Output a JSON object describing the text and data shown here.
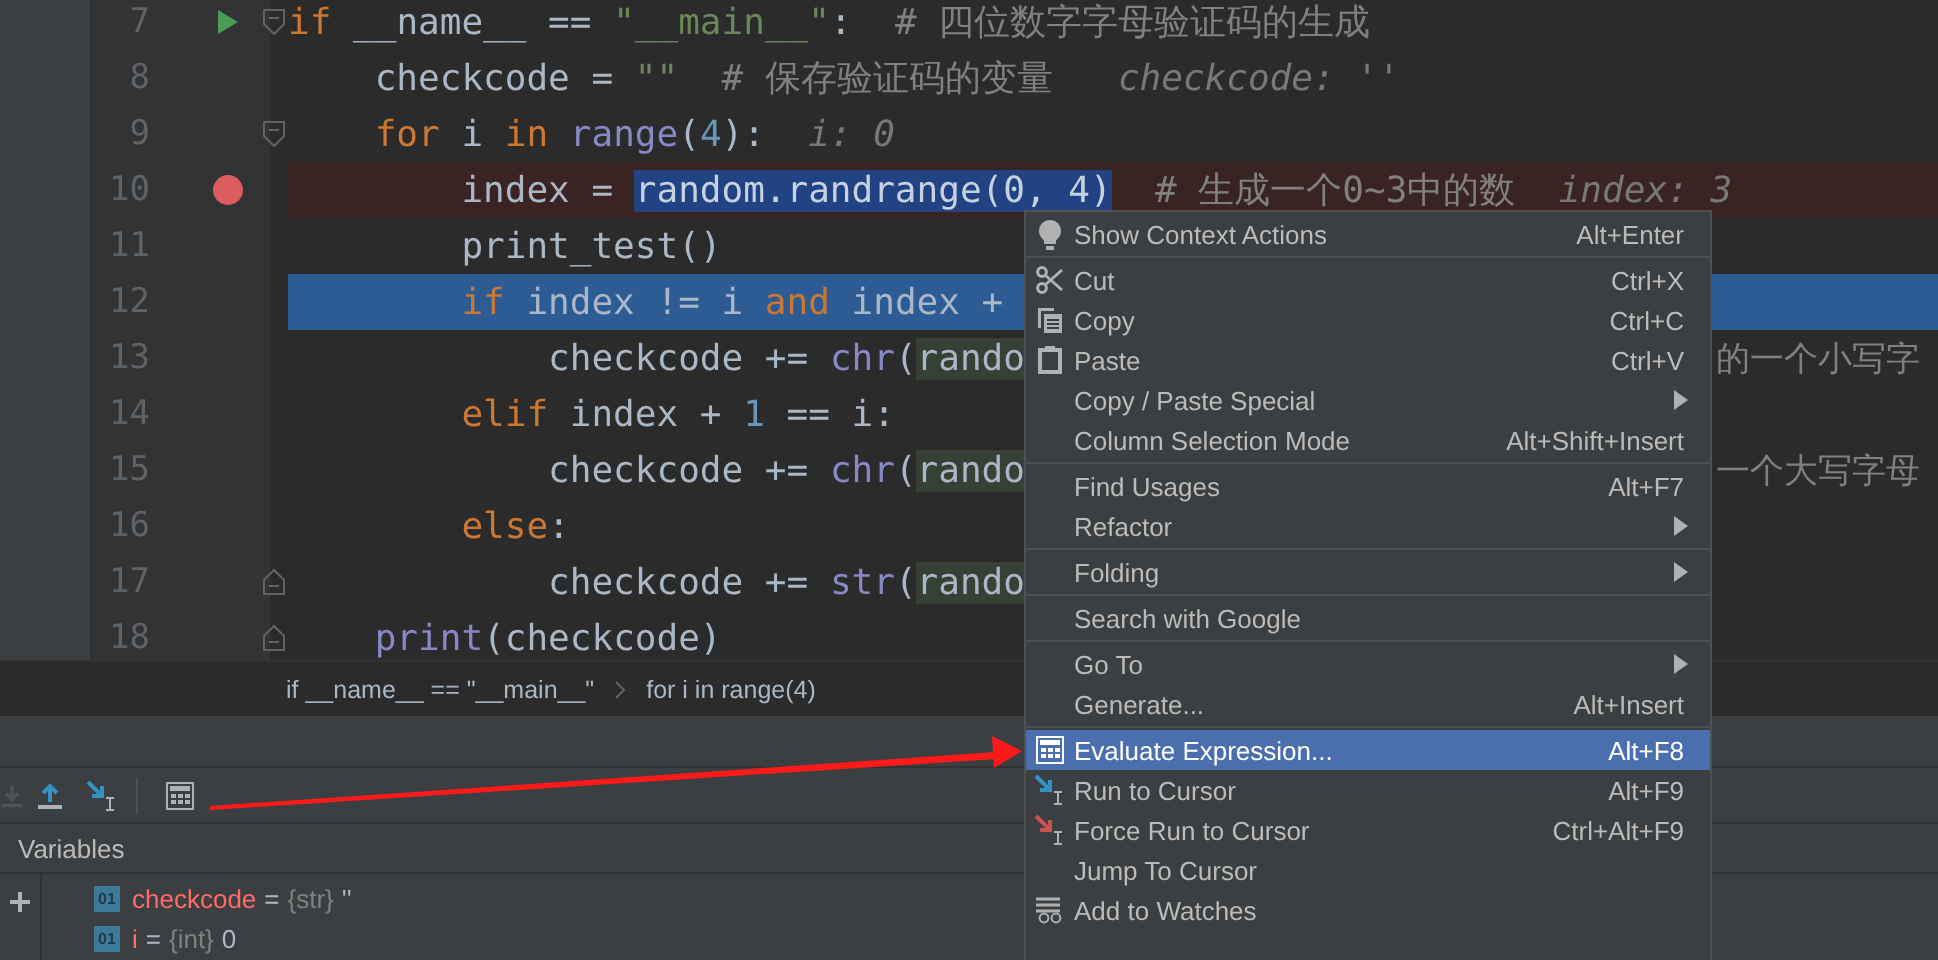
{
  "editor": {
    "lines": [
      {
        "number": "7",
        "breakpoint": false,
        "current": false,
        "tokens": [
          {
            "kind": "kw",
            "text": "if"
          },
          {
            "kind": "plain",
            "text": " __name__ == "
          },
          {
            "kind": "str",
            "text": "\"__main__\""
          },
          {
            "kind": "plain",
            "text": ":  "
          },
          {
            "kind": "comment",
            "text": "# 四位数字字母验证码的生成"
          }
        ]
      },
      {
        "number": "8",
        "breakpoint": false,
        "current": false,
        "tokens": [
          {
            "kind": "plain",
            "text": "    checkcode = "
          },
          {
            "kind": "str",
            "text": "\"\""
          },
          {
            "kind": "comment",
            "text": "  # 保存验证码的变量"
          },
          {
            "kind": "hint",
            "text": "   checkcode: ''"
          }
        ]
      },
      {
        "number": "9",
        "breakpoint": false,
        "current": false,
        "tokens": [
          {
            "kind": "kw",
            "text": "    for"
          },
          {
            "kind": "plain",
            "text": " i "
          },
          {
            "kind": "kw",
            "text": "in"
          },
          {
            "kind": "builtin",
            "text": " range"
          },
          {
            "kind": "plain",
            "text": "("
          },
          {
            "kind": "num",
            "text": "4"
          },
          {
            "kind": "plain",
            "text": "):"
          },
          {
            "kind": "hint",
            "text": "  i: 0"
          }
        ]
      },
      {
        "number": "10",
        "breakpoint": true,
        "current": false,
        "tokens": [
          {
            "kind": "plain",
            "text": "        index = "
          },
          {
            "kind": "selected",
            "text": "random.randrange(0, 4)"
          },
          {
            "kind": "comment",
            "text": "  # 生成一个0~3中的数"
          },
          {
            "kind": "hint",
            "text": "  index: 3"
          }
        ]
      },
      {
        "number": "11",
        "breakpoint": false,
        "current": false,
        "tokens": [
          {
            "kind": "plain",
            "text": "        print_test()"
          }
        ]
      },
      {
        "number": "12",
        "breakpoint": false,
        "current": true,
        "tokens": [
          {
            "kind": "kw",
            "text": "        if"
          },
          {
            "kind": "plain",
            "text": " index != i "
          },
          {
            "kind": "kw",
            "text": "and"
          },
          {
            "kind": "plain",
            "text": " index +"
          }
        ]
      },
      {
        "number": "13",
        "breakpoint": false,
        "current": false,
        "tokens": [
          {
            "kind": "plain",
            "text": "            checkcode += "
          },
          {
            "kind": "builtin",
            "text": "chr"
          },
          {
            "kind": "plain",
            "text": "("
          },
          {
            "kind": "matched",
            "text": "rando"
          }
        ],
        "tail": "的一个小写字"
      },
      {
        "number": "14",
        "breakpoint": false,
        "current": false,
        "tokens": [
          {
            "kind": "kw",
            "text": "        elif"
          },
          {
            "kind": "plain",
            "text": " index + "
          },
          {
            "kind": "num",
            "text": "1"
          },
          {
            "kind": "plain",
            "text": " == i:"
          }
        ]
      },
      {
        "number": "15",
        "breakpoint": false,
        "current": false,
        "tokens": [
          {
            "kind": "plain",
            "text": "            checkcode += "
          },
          {
            "kind": "builtin",
            "text": "chr"
          },
          {
            "kind": "plain",
            "text": "("
          },
          {
            "kind": "matched",
            "text": "rando"
          }
        ],
        "tail": "一个大写字母"
      },
      {
        "number": "16",
        "breakpoint": false,
        "current": false,
        "tokens": [
          {
            "kind": "kw",
            "text": "        else"
          },
          {
            "kind": "plain",
            "text": ":"
          }
        ]
      },
      {
        "number": "17",
        "breakpoint": false,
        "current": false,
        "tokens": [
          {
            "kind": "plain",
            "text": "            checkcode += "
          },
          {
            "kind": "builtin",
            "text": "str"
          },
          {
            "kind": "plain",
            "text": "("
          },
          {
            "kind": "matched",
            "text": "rando"
          }
        ]
      },
      {
        "number": "18",
        "breakpoint": false,
        "current": false,
        "tokens": [
          {
            "kind": "builtin",
            "text": "    print"
          },
          {
            "kind": "plain",
            "text": "(checkcode)"
          }
        ]
      }
    ]
  },
  "breadcrumbs": [
    "if __name__ == \"__main__\"",
    "for i in range(4)"
  ],
  "debug_toolbar": [
    {
      "kind": "button",
      "disabled": true
    },
    {
      "kind": "button",
      "disabled": false
    },
    {
      "kind": "button",
      "disabled": false
    },
    {
      "kind": "separator"
    },
    {
      "kind": "button",
      "disabled": false
    }
  ],
  "variables": {
    "title": "Variables",
    "items": [
      {
        "badge": "01",
        "name": "checkcode",
        "separator": "=",
        "type": "{str}",
        "value": "''"
      },
      {
        "badge": "01",
        "name": "i",
        "separator": "=",
        "type": "{int}",
        "value": "0"
      }
    ]
  },
  "context_menu": [
    {
      "kind": "item",
      "label": "Show Context Actions",
      "shortcut": "Alt+Enter",
      "submenu": false,
      "selected": false
    },
    {
      "kind": "separator"
    },
    {
      "kind": "item",
      "label": "Cut",
      "shortcut": "Ctrl+X",
      "submenu": false,
      "selected": false
    },
    {
      "kind": "item",
      "label": "Copy",
      "shortcut": "Ctrl+C",
      "submenu": false,
      "selected": false
    },
    {
      "kind": "item",
      "label": "Paste",
      "shortcut": "Ctrl+V",
      "submenu": false,
      "selected": false
    },
    {
      "kind": "item",
      "label": "Copy / Paste Special",
      "submenu": true,
      "selected": false
    },
    {
      "kind": "item",
      "label": "Column Selection Mode",
      "shortcut": "Alt+Shift+Insert",
      "submenu": false,
      "selected": false
    },
    {
      "kind": "separator"
    },
    {
      "kind": "item",
      "label": "Find Usages",
      "shortcut": "Alt+F7",
      "submenu": false,
      "selected": false
    },
    {
      "kind": "item",
      "label": "Refactor",
      "submenu": true,
      "selected": false
    },
    {
      "kind": "separator"
    },
    {
      "kind": "item",
      "label": "Folding",
      "submenu": true,
      "selected": false
    },
    {
      "kind": "separator"
    },
    {
      "kind": "item",
      "label": "Search with Google",
      "submenu": false,
      "selected": false
    },
    {
      "kind": "separator"
    },
    {
      "kind": "item",
      "label": "Go To",
      "submenu": true,
      "selected": false
    },
    {
      "kind": "item",
      "label": "Generate...",
      "shortcut": "Alt+Insert",
      "submenu": false,
      "selected": false
    },
    {
      "kind": "separator"
    },
    {
      "kind": "item",
      "label": "Evaluate Expression...",
      "shortcut": "Alt+F8",
      "submenu": false,
      "selected": true
    },
    {
      "kind": "item",
      "label": "Run to Cursor",
      "shortcut": "Alt+F9",
      "submenu": false,
      "selected": false
    },
    {
      "kind": "item",
      "label": "Force Run to Cursor",
      "shortcut": "Ctrl+Alt+F9",
      "submenu": false,
      "selected": false
    },
    {
      "kind": "item",
      "label": "Jump To Cursor",
      "submenu": false,
      "selected": false
    },
    {
      "kind": "item",
      "label": "Add to Watches",
      "submenu": false,
      "selected": false
    }
  ]
}
